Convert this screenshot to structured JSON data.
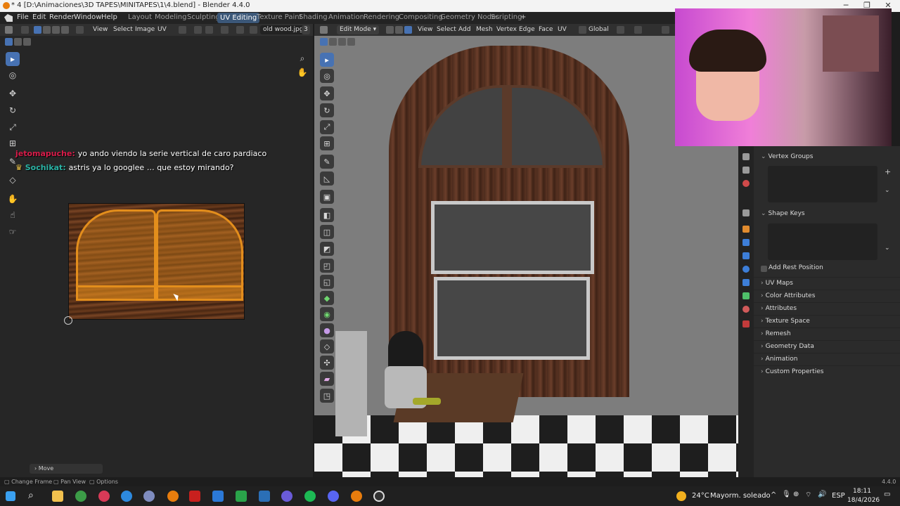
{
  "window": {
    "title": "* 4 [D:\\Animaciones\\3D TAPES\\MINITAPES\\1\\4.blend] - Blender 4.4.0",
    "minimize": "─",
    "maximize": "❐",
    "close": "✕"
  },
  "menu": {
    "items": [
      "File",
      "Edit",
      "Render",
      "Window",
      "Help"
    ],
    "workspaces": [
      "Layout",
      "Modeling",
      "Sculpting",
      "UV Editing",
      "Texture Paint",
      "Shading",
      "Animation",
      "Rendering",
      "Compositing",
      "Geometry Nodes",
      "Scripting"
    ],
    "active_workspace": "UV Editing",
    "add_workspace": "+"
  },
  "uv_header": {
    "menus": [
      "View",
      "Select",
      "Image",
      "UV"
    ],
    "image_name": "old wood.jpg",
    "user_count": "3"
  },
  "viewport_header": {
    "mode": "Edit Mode",
    "menus": [
      "View",
      "Select",
      "Add",
      "Mesh",
      "Vertex",
      "Edge",
      "Face",
      "UV"
    ],
    "orientation": "Global"
  },
  "chat": [
    {
      "user": "jetomapuche:",
      "message": "yo ando viendo la serie vertical de caro pardiaco"
    },
    {
      "user": "Sochikat:",
      "message": "astris ya lo googlee … que estoy mirando?"
    }
  ],
  "properties": {
    "vertex_groups": "Vertex Groups",
    "shape_keys": "Shape Keys",
    "add_rest_position": "Add Rest Position",
    "sections": [
      "UV Maps",
      "Color Attributes",
      "Attributes",
      "Texture Space",
      "Remesh",
      "Geometry Data",
      "Animation",
      "Custom Properties"
    ]
  },
  "operator_panel": {
    "label": "Move"
  },
  "statusbar": {
    "items": [
      "Change Frame",
      "Pan View",
      "Options"
    ],
    "version": "4.4.0"
  },
  "taskbar": {
    "weather_temp": "24°C",
    "weather_desc": "Mayorm. soleado",
    "language": "ESP",
    "time": "18:11",
    "date": "18/4/2026"
  },
  "colors": {
    "accent": "#4772b3",
    "uv_selection": "#e38e1c",
    "workspace_active": "#3b5778"
  }
}
